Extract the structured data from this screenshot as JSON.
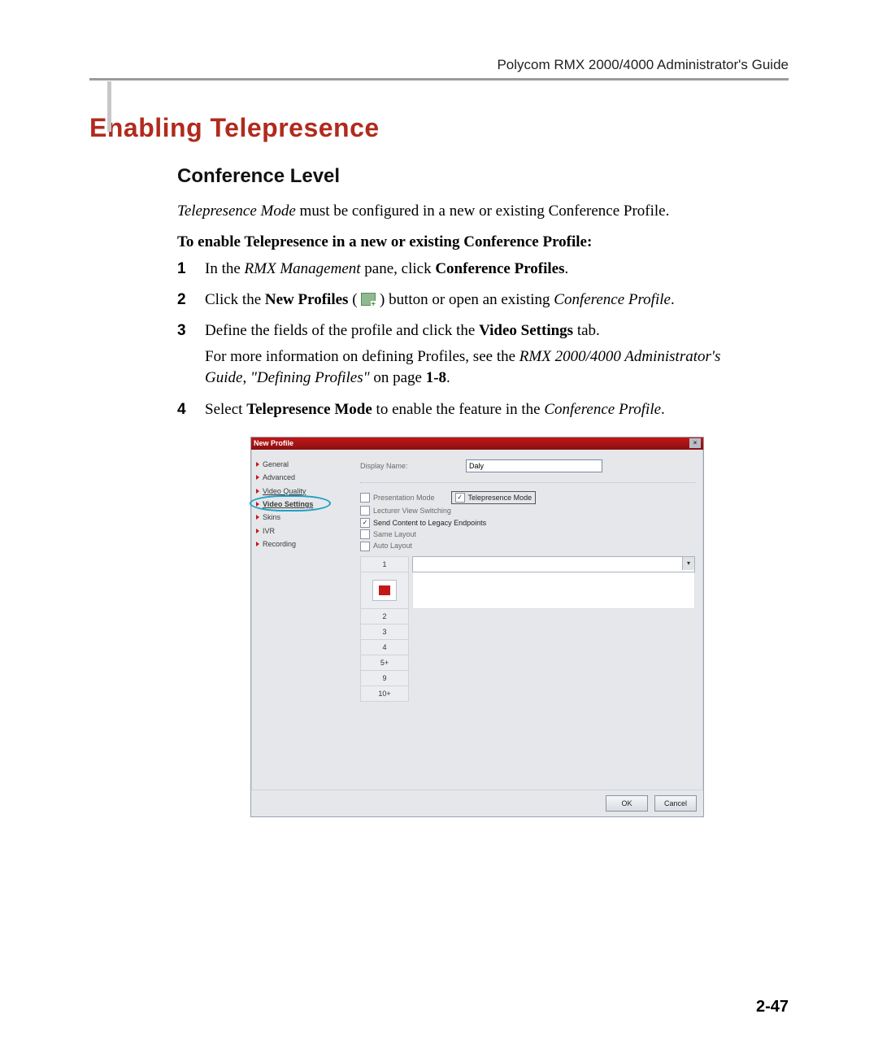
{
  "running_head": "Polycom RMX 2000/4000 Administrator's Guide",
  "h1": "Enabling Telepresence",
  "h2": "Conference Level",
  "intro": {
    "pre_em": "Telepresence Mode",
    "post_em": " must be configured in a new or existing Conference Profile."
  },
  "lede": "To enable Telepresence in a new or existing Conference Profile:",
  "steps": [
    {
      "n": "1",
      "html": "In the <em>RMX Management</em> pane, click <b>Conference Profiles</b>."
    },
    {
      "n": "2",
      "html": "Click the <b>New Profiles</b> ( <span class=\"inline-icon\" data-name=\"new-profile-icon\" data-interactable=\"false\"></span> ) button or open an existing <em>Conference Profile</em>."
    },
    {
      "n": "3",
      "html": "Define the fields of the profile and click the <b>Video Settings</b> tab.",
      "extra": "For more information on defining Profiles, see the <em>RMX 2000/4000 Administrator's Guide</em>, <em>\"Defining Profiles\"</em> on page <b>1-8</b>."
    },
    {
      "n": "4",
      "html": "Select <b>Telepresence Mode</b> to enable the feature in the <em>Conference Profile</em>."
    }
  ],
  "dlg": {
    "title": "New Profile",
    "nav": [
      "General",
      "Advanced",
      "Video Quality",
      "Video Settings",
      "Skins",
      "IVR",
      "Recording"
    ],
    "display_name_label": "Display Name:",
    "display_name_value": "Daly",
    "cb_presentation": "Presentation Mode",
    "cb_telepresence": "Telepresence Mode",
    "cb_lecturer": "Lecturer View Switching",
    "cb_legacy": "Send Content to Legacy Endpoints",
    "cb_same": "Same Layout",
    "cb_auto": "Auto Layout",
    "layout_rows": [
      "1",
      "2",
      "3",
      "4",
      "5+",
      "9",
      "10+"
    ],
    "ok": "OK",
    "cancel": "Cancel"
  },
  "pagenum": "2-47"
}
